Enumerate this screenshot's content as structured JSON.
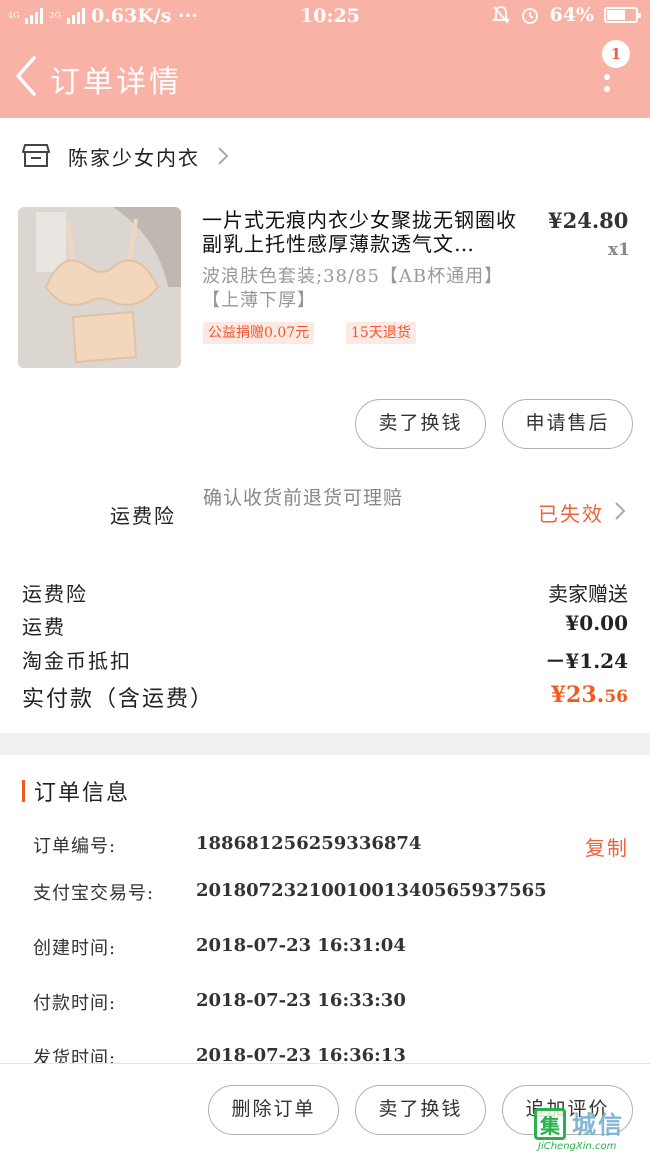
{
  "status_bar": {
    "network": "4G",
    "network2": "2G",
    "speed": "0.63K/s ···",
    "time": "10:25",
    "battery": "64%",
    "battery_level": 0.64
  },
  "header": {
    "title": "订单详情",
    "badge": "1"
  },
  "shop": {
    "name": "陈家少女内衣"
  },
  "product": {
    "title": "一片式无痕内衣少女聚拢无钢圈收副乳上托性感厚薄款透气文…",
    "price": "¥24.80",
    "qty": "x1",
    "sku": "波浪肤色套装;38/85【AB杯通用】【上薄下厚】",
    "tags": [
      "公益捐赠0.07元",
      "15天退货"
    ],
    "actions": [
      "卖了换钱",
      "申请售后"
    ]
  },
  "insurance": {
    "label": "运费险",
    "description": "确认收货前退货可理赔",
    "status": "已失效"
  },
  "summary": [
    {
      "label": "运费险",
      "value": "卖家赠送"
    },
    {
      "label": "运费",
      "value": "¥0.00"
    },
    {
      "label": "淘金币抵扣",
      "value": "－¥1.24"
    }
  ],
  "paid": {
    "label": "实付款（含运费）",
    "currency": "¥",
    "integer": "23.",
    "decimal": "56"
  },
  "order_info": {
    "title": "订单信息",
    "copy_label": "复制",
    "rows": [
      {
        "label": "订单编号:",
        "value": "188681256259336874"
      },
      {
        "label": "支付宝交易号:",
        "value": "2018072321001001340565937565"
      },
      {
        "label": "创建时间:",
        "value": "2018-07-23 16:31:04"
      },
      {
        "label": "付款时间:",
        "value": "2018-07-23 16:33:30"
      },
      {
        "label": "发货时间:",
        "value": "2018-07-23 16:36:13"
      }
    ]
  },
  "bottom_actions": [
    "删除订单",
    "卖了换钱",
    "追加评价"
  ],
  "watermark": {
    "cn": "城信",
    "en": "JiChengXin.com"
  },
  "colors": {
    "header_bg": "#f9b2a6",
    "accent": "#f25a1e",
    "tag_bg": "#fde9e3"
  }
}
